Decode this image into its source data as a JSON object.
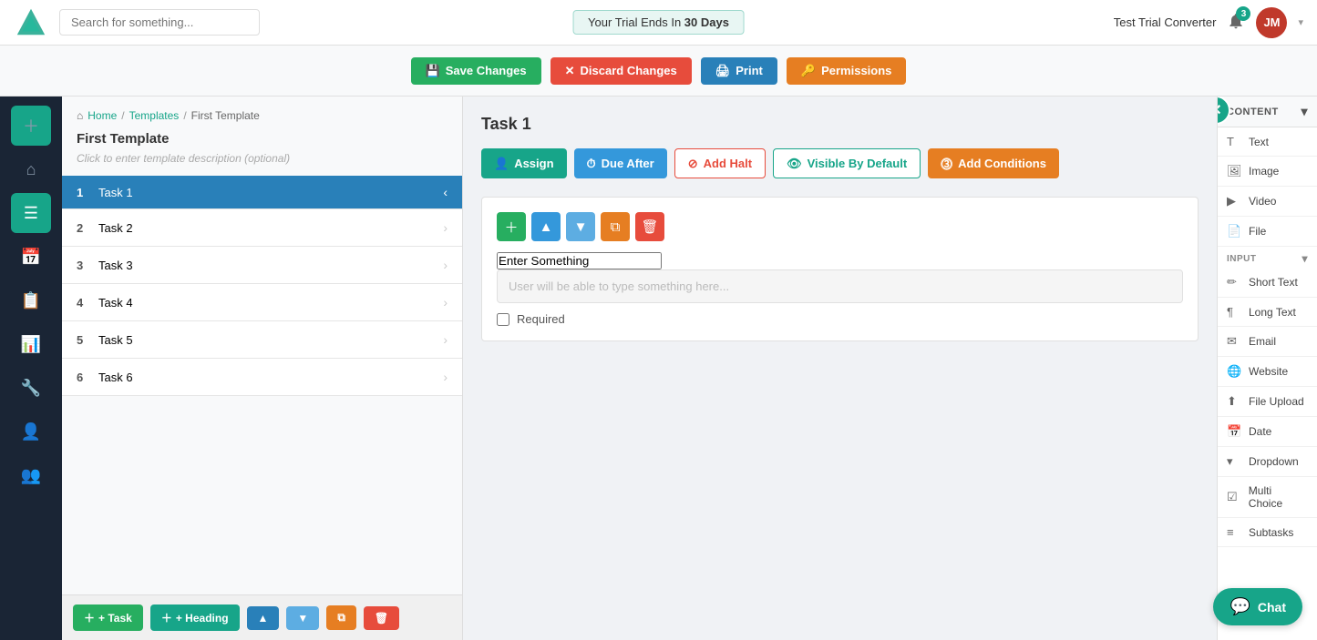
{
  "topbar": {
    "search_placeholder": "Search for something...",
    "trial_text": "Your Trial Ends In ",
    "trial_days": "30 Days",
    "workspace_name": "Test Trial Converter",
    "notif_count": "3",
    "avatar_initials": "JM"
  },
  "action_bar": {
    "save_changes": "Save Changes",
    "discard_changes": "Discard Changes",
    "print": "Print",
    "permissions": "Permissions"
  },
  "breadcrumb": {
    "home": "Home",
    "templates": "Templates",
    "current": "First Template"
  },
  "template": {
    "title": "First Template",
    "description": "Click to enter template description (optional)"
  },
  "tasks": [
    {
      "num": 1,
      "name": "Task 1",
      "active": true
    },
    {
      "num": 2,
      "name": "Task 2",
      "active": false
    },
    {
      "num": 3,
      "name": "Task 3",
      "active": false
    },
    {
      "num": 4,
      "name": "Task 4",
      "active": false
    },
    {
      "num": 5,
      "name": "Task 5",
      "active": false
    },
    {
      "num": 6,
      "name": "Task 6",
      "active": false
    }
  ],
  "bottom_bar": {
    "add_task": "+ Task",
    "add_heading": "+ Heading"
  },
  "content": {
    "task_title": "Task 1",
    "assign_btn": "Assign",
    "due_after_btn": "Due After",
    "add_halt_btn": "Add Halt",
    "visible_default_btn": "Visible By Default",
    "add_conditions_btn": "Add Conditions",
    "block": {
      "label_placeholder": "Enter Something",
      "input_placeholder": "User will be able to type something here...",
      "required_label": "Required"
    }
  },
  "right_sidebar": {
    "header": "CONTENT",
    "content_items": [
      {
        "icon": "T",
        "label": "Text"
      },
      {
        "icon": "🖼",
        "label": "Image"
      },
      {
        "icon": "▶",
        "label": "Video"
      },
      {
        "icon": "📄",
        "label": "File"
      }
    ],
    "input_label": "INPUT",
    "input_items": [
      {
        "icon": "✏",
        "label": "Short Text"
      },
      {
        "icon": "¶",
        "label": "Long Text"
      },
      {
        "icon": "✉",
        "label": "Email"
      },
      {
        "icon": "🌐",
        "label": "Website"
      },
      {
        "icon": "⬆",
        "label": "File Upload"
      },
      {
        "icon": "📅",
        "label": "Date"
      },
      {
        "icon": "▾",
        "label": "Dropdown"
      },
      {
        "icon": "☑",
        "label": "Multi Choice"
      },
      {
        "icon": "≡",
        "label": "Subtasks"
      }
    ]
  },
  "chat_btn": "Chat"
}
